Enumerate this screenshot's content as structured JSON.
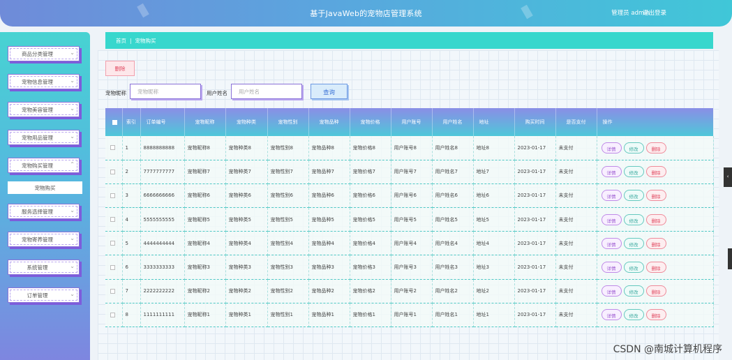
{
  "header": {
    "title": "基于JavaWeb的宠物店管理系统",
    "user": "管理员 admin",
    "logout": "退出登录"
  },
  "sidebar": {
    "items": [
      {
        "label": "商品分类管理",
        "chevron": "⌄"
      },
      {
        "label": "宠物信息管理",
        "chevron": "⌄"
      },
      {
        "label": "宠物美容管理",
        "chevron": "⌄"
      },
      {
        "label": "宠物用品管理",
        "chevron": "⌄"
      },
      {
        "label": "宠物购买管理",
        "chevron": "⌃"
      },
      {
        "label": "服务选择管理",
        "chevron": "⌄"
      },
      {
        "label": "宠物寄养管理",
        "chevron": "⌄"
      },
      {
        "label": "系统管理",
        "chevron": "⌄"
      },
      {
        "label": "订单管理",
        "chevron": "⌄"
      }
    ],
    "submenu": {
      "label": "宠物购买"
    }
  },
  "breadcrumb": {
    "home": "首页",
    "sep": "|",
    "current": "宠物购买"
  },
  "toolbar": {
    "delete_label": "删除"
  },
  "search": {
    "pet_name_label": "宠物昵称",
    "pet_name_placeholder": "宠物昵称",
    "user_name_label": "用户姓名",
    "user_name_placeholder": "用户姓名",
    "search_label": "查询"
  },
  "table": {
    "headers": [
      "索引",
      "订单编号",
      "宠物昵称",
      "宠物种类",
      "宠物性别",
      "宠物品种",
      "宠物价格",
      "用户账号",
      "用户姓名",
      "地址",
      "购买时间",
      "是否支付",
      "操作"
    ],
    "rows": [
      [
        "1",
        "8888888888",
        "宠物昵称8",
        "宠物种类8",
        "宠物性别8",
        "宠物品种8",
        "宠物价格8",
        "用户账号8",
        "用户姓名8",
        "地址8",
        "2023-01-17",
        "未支付"
      ],
      [
        "2",
        "7777777777",
        "宠物昵称7",
        "宠物种类7",
        "宠物性别7",
        "宠物品种7",
        "宠物价格7",
        "用户账号7",
        "用户姓名7",
        "地址7",
        "2023-01-17",
        "未支付"
      ],
      [
        "3",
        "6666666666",
        "宠物昵称6",
        "宠物种类6",
        "宠物性别6",
        "宠物品种6",
        "宠物价格6",
        "用户账号6",
        "用户姓名6",
        "地址6",
        "2023-01-17",
        "未支付"
      ],
      [
        "4",
        "5555555555",
        "宠物昵称5",
        "宠物种类5",
        "宠物性别5",
        "宠物品种5",
        "宠物价格5",
        "用户账号5",
        "用户姓名5",
        "地址5",
        "2023-01-17",
        "未支付"
      ],
      [
        "5",
        "4444444444",
        "宠物昵称4",
        "宠物种类4",
        "宠物性别4",
        "宠物品种4",
        "宠物价格4",
        "用户账号4",
        "用户姓名4",
        "地址4",
        "2023-01-17",
        "未支付"
      ],
      [
        "6",
        "3333333333",
        "宠物昵称3",
        "宠物种类3",
        "宠物性别3",
        "宠物品种3",
        "宠物价格3",
        "用户账号3",
        "用户姓名3",
        "地址3",
        "2023-01-17",
        "未支付"
      ],
      [
        "7",
        "2222222222",
        "宠物昵称2",
        "宠物种类2",
        "宠物性别2",
        "宠物品种2",
        "宠物价格2",
        "用户账号2",
        "用户姓名2",
        "地址2",
        "2023-01-17",
        "未支付"
      ],
      [
        "8",
        "1111111111",
        "宠物昵称1",
        "宠物种类1",
        "宠物性别1",
        "宠物品种1",
        "宠物价格1",
        "用户账号1",
        "用户姓名1",
        "地址1",
        "2023-01-17",
        "未支付"
      ]
    ],
    "actions": {
      "detail": "详情",
      "edit": "修改",
      "delete": "删除"
    }
  },
  "watermark": "CSDN @南城计算机程序",
  "edge_tab_icon": "‹"
}
